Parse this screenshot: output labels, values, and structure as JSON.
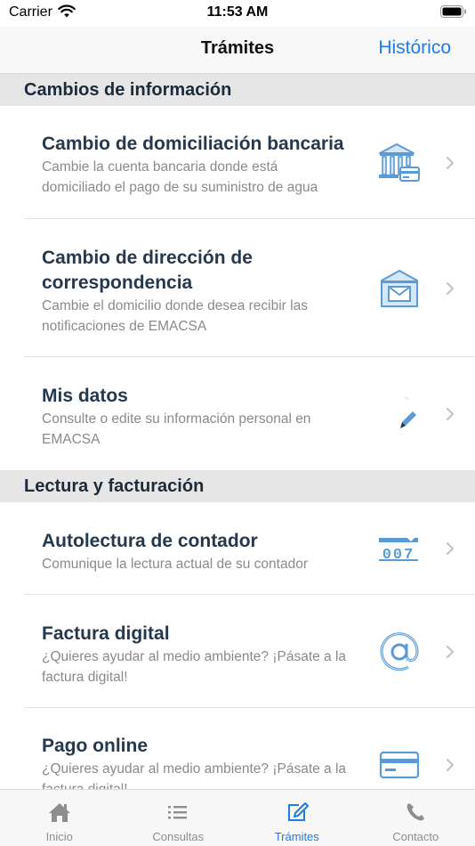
{
  "status_bar": {
    "carrier": "Carrier",
    "time": "11:53 AM"
  },
  "nav": {
    "title": "Trámites",
    "right_button": "Histórico"
  },
  "sections": [
    {
      "header": "Cambios de información",
      "items": [
        {
          "title": "Cambio de domiciliación bancaria",
          "description": "Cambie la cuenta bancaria donde está domiciliado el pago de su suministro de agua",
          "icon": "bank-icon"
        },
        {
          "title": "Cambio de dirección de correspondencia",
          "description": "Cambie el domicilio donde desea recibir las notificaciones de EMACSA",
          "icon": "mailbox-icon"
        },
        {
          "title": "Mis datos",
          "description": "Consulte o edite su información personal en EMACSA",
          "icon": "pencil-icon"
        }
      ]
    },
    {
      "header": "Lectura y facturación",
      "items": [
        {
          "title": "Autolectura de contador",
          "description": "Comunique la lectura actual de su contador",
          "icon": "meter-icon",
          "meter_digits": "007"
        },
        {
          "title": "Factura digital",
          "description": "¿Quieres ayudar al medio ambiente? ¡Pásate a la factura digital!",
          "icon": "at-sign-icon"
        },
        {
          "title": "Pago online",
          "description": "¿Quieres ayudar al medio ambiente? ¡Pásate a la factura digital!",
          "icon": "credit-card-icon"
        }
      ]
    }
  ],
  "tabs": [
    {
      "label": "Inicio",
      "icon": "home-icon",
      "active": false
    },
    {
      "label": "Consultas",
      "icon": "list-icon",
      "active": false
    },
    {
      "label": "Trámites",
      "icon": "edit-icon",
      "active": true
    },
    {
      "label": "Contacto",
      "icon": "phone-icon",
      "active": false
    }
  ],
  "colors": {
    "accent": "#1a7ee6",
    "icon_blue": "#5b9bd5",
    "section_bg": "#e6e6e6",
    "title": "#24394e",
    "description": "#8a8a8a"
  }
}
